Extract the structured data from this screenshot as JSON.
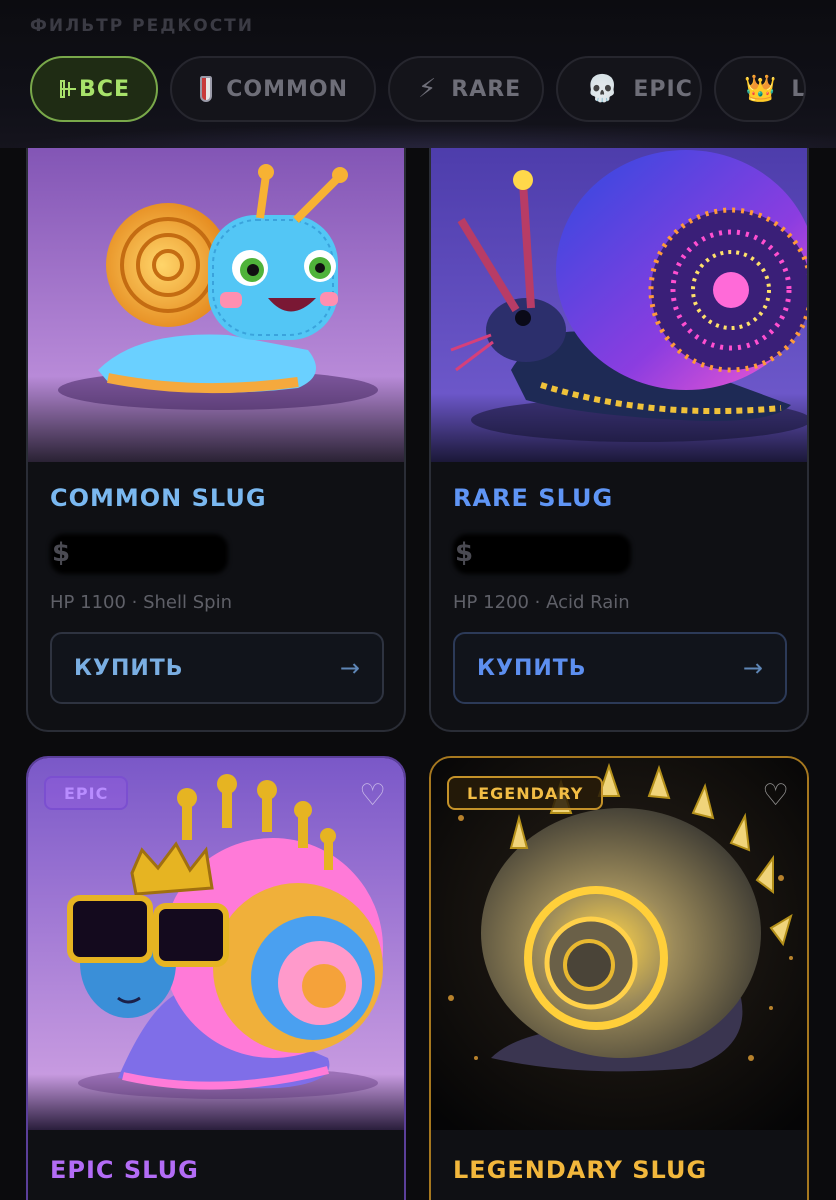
{
  "filter": {
    "title": "ФИЛЬТР РЕДКОСТИ",
    "chips": [
      {
        "label": "ВСЕ",
        "icon": "grid-icon",
        "active": true
      },
      {
        "label": "COMMON",
        "icon": "shield-icon",
        "active": false
      },
      {
        "label": "RARE",
        "icon": "lightning-icon",
        "glyph": "⚡",
        "active": false
      },
      {
        "label": "EPIC",
        "icon": "skull-icon",
        "glyph": "💀",
        "active": false
      },
      {
        "label": "LE",
        "icon": "crown-icon",
        "glyph": "👑",
        "active": false
      }
    ]
  },
  "cards": [
    {
      "title": "COMMON SLUG",
      "price_glyph": "$",
      "stats": "HP 1100 · Shell Spin",
      "buy_label": "КУПИТЬ",
      "arrow": "→",
      "title_color": "#7ab8f0"
    },
    {
      "title": "RARE SLUG",
      "price_glyph": "$",
      "stats": "HP 1200 · Acid Rain",
      "buy_label": "КУПИТЬ",
      "arrow": "→",
      "title_color": "#5f95f5"
    },
    {
      "title": "EPIC SLUG",
      "badge": "EPIC",
      "heart": "♡",
      "title_color": "#b36cf6"
    },
    {
      "title": "LEGENDARY SLUG",
      "badge": "LEGENDARY",
      "heart": "♡",
      "title_color": "#f2b73c"
    }
  ],
  "colors": {
    "accent_green": "#a7e26a",
    "epic_purple": "#b36cf6",
    "legendary_gold": "#f2b73c",
    "rare_blue": "#5f95f5"
  }
}
